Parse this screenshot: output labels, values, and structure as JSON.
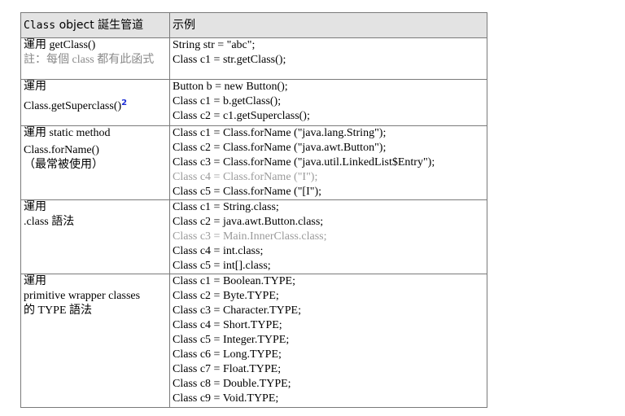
{
  "header": {
    "col1_code": "Class",
    "col1_rest": " object 誕生管道",
    "col2": "示例"
  },
  "rows": [
    {
      "left": [
        "運用 getClass()"
      ],
      "left_note": "註：每個 class 都有此函式",
      "code": [
        {
          "text": "String str = \"abc\";",
          "muted": false
        },
        {
          "text": "Class c1 = str.getClass();",
          "muted": false
        }
      ]
    },
    {
      "left": [
        "運用",
        "Class.getSuperclass()"
      ],
      "footnote": "2",
      "code": [
        {
          "text": "Button b = new Button();",
          "muted": false
        },
        {
          "text": "Class c1 = b.getClass();",
          "muted": false
        },
        {
          "text": "Class c2 = c1.getSuperclass();",
          "muted": false
        }
      ]
    },
    {
      "left": [
        "運用 static method",
        "Class.forName()",
        "（最常被使用）"
      ],
      "code": [
        {
          "text": "Class c1 = Class.forName (\"java.lang.String\");",
          "muted": false
        },
        {
          "text": "Class c2 = Class.forName (\"java.awt.Button\");",
          "muted": false
        },
        {
          "text": "Class c3 = Class.forName (\"java.util.LinkedList$Entry\");",
          "muted": false
        },
        {
          "text": "Class c4 = Class.forName (\"I\");",
          "muted": true
        },
        {
          "text": "Class c5 = Class.forName (\"[I\");",
          "muted": false
        }
      ]
    },
    {
      "left": [
        "運用",
        ".class 語法"
      ],
      "code": [
        {
          "text": "Class c1 = String.class;",
          "muted": false
        },
        {
          "text": "Class c2 = java.awt.Button.class;",
          "muted": false
        },
        {
          "text": "Class c3 = Main.InnerClass.class;",
          "muted": true
        },
        {
          "text": "Class c4 = int.class;",
          "muted": false
        },
        {
          "text": "Class c5 = int[].class;",
          "muted": false
        }
      ]
    },
    {
      "left": [
        "運用",
        "primitive wrapper classes",
        "的 TYPE 語法"
      ],
      "code": [
        {
          "text": "Class c1 = Boolean.TYPE;",
          "muted": false
        },
        {
          "text": "Class c2 = Byte.TYPE;",
          "muted": false
        },
        {
          "text": "Class c3 = Character.TYPE;",
          "muted": false
        },
        {
          "text": "Class c4 = Short.TYPE;",
          "muted": false
        },
        {
          "text": "Class c5 = Integer.TYPE;",
          "muted": false
        },
        {
          "text": "Class c6 = Long.TYPE;",
          "muted": false
        },
        {
          "text": "Class c7 = Float.TYPE;",
          "muted": false
        },
        {
          "text": "Class c8 = Double.TYPE;",
          "muted": false
        },
        {
          "text": "Class c9 = Void.TYPE;",
          "muted": false
        }
      ]
    }
  ]
}
